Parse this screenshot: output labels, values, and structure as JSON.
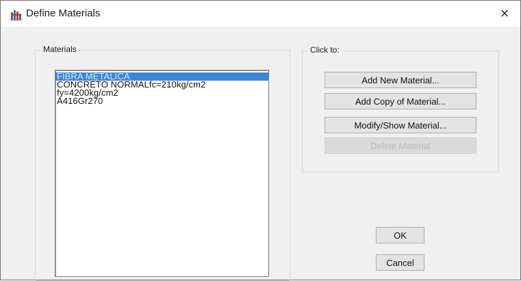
{
  "window": {
    "title": "Define Materials",
    "close_glyph": "×",
    "icon": "app-icon"
  },
  "materials_group": {
    "label": "Materials",
    "items": [
      {
        "label": "FIBRA METALICA",
        "selected": true
      },
      {
        "label": "CONCRETO NORMALfc=210kg/cm2",
        "selected": false
      },
      {
        "label": "fy=4200kg/cm2",
        "selected": false
      },
      {
        "label": "A416Gr270",
        "selected": false
      }
    ]
  },
  "click_group": {
    "label": "Click to:",
    "add_new": "Add New Material...",
    "add_copy": "Add Copy of Material...",
    "modify_show": "Modify/Show Material...",
    "delete": "Delete Material"
  },
  "dialog_buttons": {
    "ok": "OK",
    "cancel": "Cancel"
  },
  "colors": {
    "selection": "#3b86d6",
    "dialog_bg": "#f0f0f0"
  }
}
